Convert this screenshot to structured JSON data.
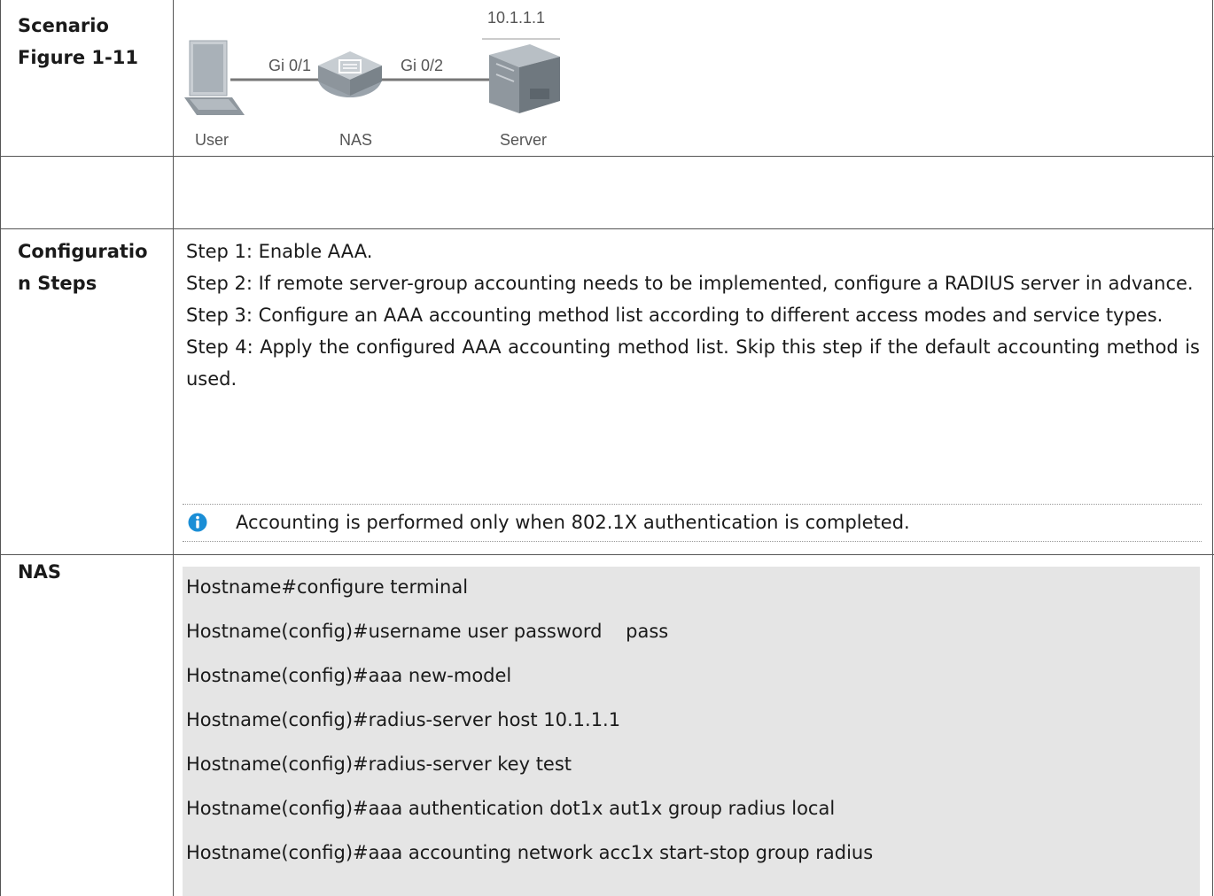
{
  "scenario": {
    "label_line1": "Scenario",
    "label_line2": "Figure 1-11",
    "diagram": {
      "server_ip": "10.1.1.1",
      "port_left": "Gi 0/1",
      "port_right": "Gi 0/2",
      "node_user": "User",
      "node_nas": "NAS",
      "node_server": "Server"
    }
  },
  "config_steps": {
    "label_line1": "Configuratio",
    "label_line2": "n Steps",
    "steps": [
      "Step 1: Enable AAA.",
      "Step 2: If remote server-group accounting needs to be implemented, configure a RADIUS server in advance.",
      "Step 3: Configure an AAA accounting method list according to different access modes and service types.",
      "Step 4: Apply the configured AAA accounting method list. Skip this step if the default accounting method is used."
    ],
    "note": "Accounting is performed only when 802.1X authentication is completed."
  },
  "nas": {
    "label": "NAS",
    "commands": [
      "Hostname#configure terminal",
      "Hostname(config)#username user password    pass",
      "Hostname(config)#aaa new-model",
      "Hostname(config)#radius-server host 10.1.1.1",
      "Hostname(config)#radius-server key test",
      "Hostname(config)#aaa authentication dot1x aut1x group radius local",
      "Hostname(config)#aaa accounting network acc1x start-stop group radius"
    ]
  },
  "colors": {
    "border": "#555555",
    "code_background": "#e5e5e5",
    "note_icon": "#1a8ed6"
  }
}
